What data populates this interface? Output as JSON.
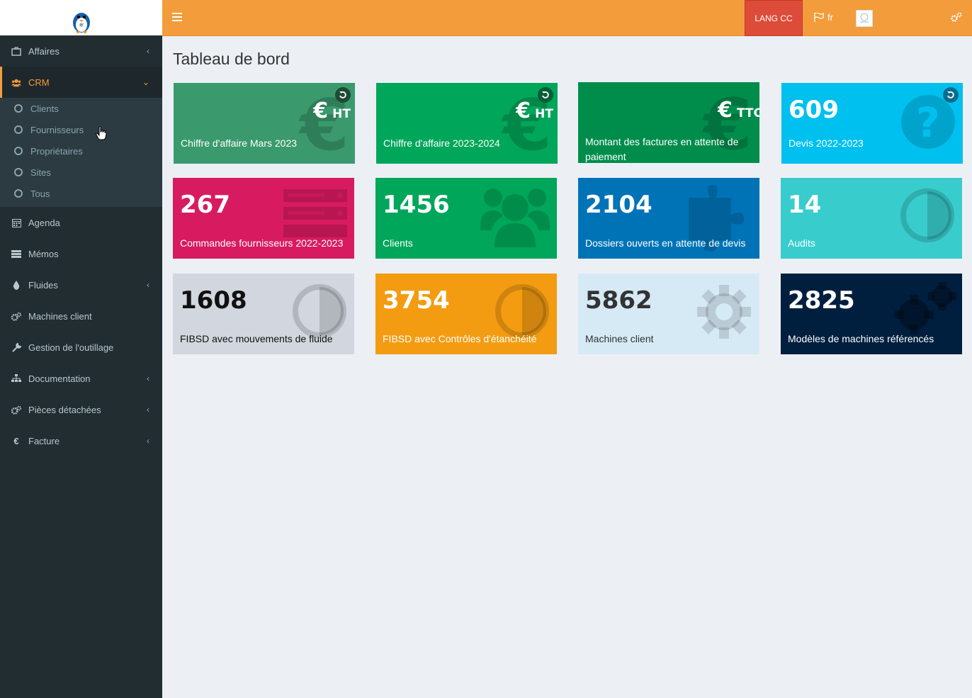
{
  "header": {
    "lang_button": "LANG CC",
    "language": "fr"
  },
  "sidebar": {
    "items": [
      {
        "label": "Affaires",
        "icon": "briefcase-icon",
        "has_caret": true
      },
      {
        "label": "CRM",
        "icon": "users-icon",
        "has_caret": true,
        "active": true
      },
      {
        "label": "Agenda",
        "icon": "calendar-icon"
      },
      {
        "label": "Mémos",
        "icon": "list-icon"
      },
      {
        "label": "Fluides",
        "icon": "droplet-icon",
        "has_caret": true
      },
      {
        "label": "Machines client",
        "icon": "gears-icon"
      },
      {
        "label": "Gestion de l'outillage",
        "icon": "wrench-icon"
      },
      {
        "label": "Documentation",
        "icon": "sitemap-icon",
        "has_caret": true
      },
      {
        "label": "Pièces détachées",
        "icon": "gears-icon",
        "has_caret": true
      },
      {
        "label": "Facture",
        "icon": "euro-icon",
        "has_caret": true
      }
    ],
    "crm_sub": [
      "Clients",
      "Fournisseurs",
      "Propriétaires",
      "Sites",
      "Tous"
    ]
  },
  "page": {
    "title": "Tableau de bord"
  },
  "cards": [
    {
      "value": "",
      "label": "Chiffre d'affaire Mars 2023",
      "tag": "HT",
      "color": "#3a9a6e",
      "icon": "euro-icon"
    },
    {
      "value": "",
      "label": "Chiffre d'affaire 2023-2024",
      "tag": "HT",
      "color": "#00a65a",
      "icon": "euro-icon"
    },
    {
      "value": "",
      "label": "Montant des factures en attente de paiement",
      "tag": "TTC",
      "color": "#008d4c",
      "icon": "euro-icon"
    },
    {
      "value": "609",
      "label": "Devis 2022-2023",
      "color": "#00c0ef",
      "icon": "question-circle-icon"
    },
    {
      "value": "267",
      "label": "Commandes fournisseurs 2022-2023",
      "color": "#d81b60",
      "icon": "server-icon"
    },
    {
      "value": "1456",
      "label": "Clients",
      "color": "#00a65a",
      "icon": "users-icon"
    },
    {
      "value": "2104",
      "label": "Dossiers ouverts en attente de devis",
      "color": "#0073b7",
      "icon": "puzzle-icon"
    },
    {
      "value": "14",
      "label": "Audits",
      "color": "#39cccc",
      "icon": "adjust-icon"
    },
    {
      "value": "1608",
      "label": "FIBSD avec mouvements de fluide",
      "color": "#d2d6de",
      "icon": "adjust-icon"
    },
    {
      "value": "3754",
      "label": "FIBSD avec Contrôles d'étanchéité",
      "color": "#f39c12",
      "icon": "adjust-icon"
    },
    {
      "value": "5862",
      "label": "Machines client",
      "color": "#d6eaf6",
      "icon": "gear-icon"
    },
    {
      "value": "2825",
      "label": "Modèles de machines référencés",
      "color": "#001f3f",
      "icon": "gears-icon"
    }
  ]
}
